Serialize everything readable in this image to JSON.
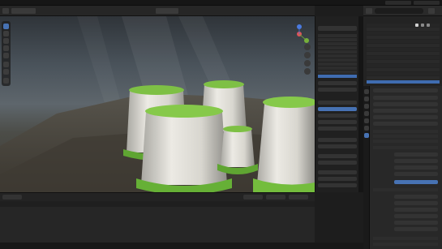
{
  "app": {
    "title": ""
  },
  "menubar": {
    "items": [],
    "workspace_tabs": [],
    "scene": "",
    "view_layer": ""
  },
  "toolbar": {
    "mode": "",
    "view_menu": "",
    "select_menu": "",
    "add_menu": "",
    "object_menu": "",
    "orientation": ""
  },
  "viewport": {
    "overlay_line1": "",
    "overlay_line2": ""
  },
  "outliner": {
    "title": "",
    "rows": []
  },
  "npanel": {
    "title": "",
    "rows": []
  },
  "properties": {
    "rows": []
  },
  "timeline": {
    "mode": "",
    "frame": "",
    "start": "",
    "end": ""
  },
  "status": {
    "left": "",
    "right": ""
  },
  "colors": {
    "accent": "#4772b3",
    "grass": "#6bbf3a",
    "stump": "#e8e6df",
    "panel": "#282828"
  },
  "icons": [
    "cursor-icon",
    "move-icon",
    "rotate-icon",
    "scale-icon",
    "transform-icon",
    "annotate-icon",
    "measure-icon",
    "zoom-icon",
    "hand-icon",
    "camera-icon",
    "grid-icon",
    "eye-icon",
    "restrict-icon",
    "funnel-icon"
  ]
}
